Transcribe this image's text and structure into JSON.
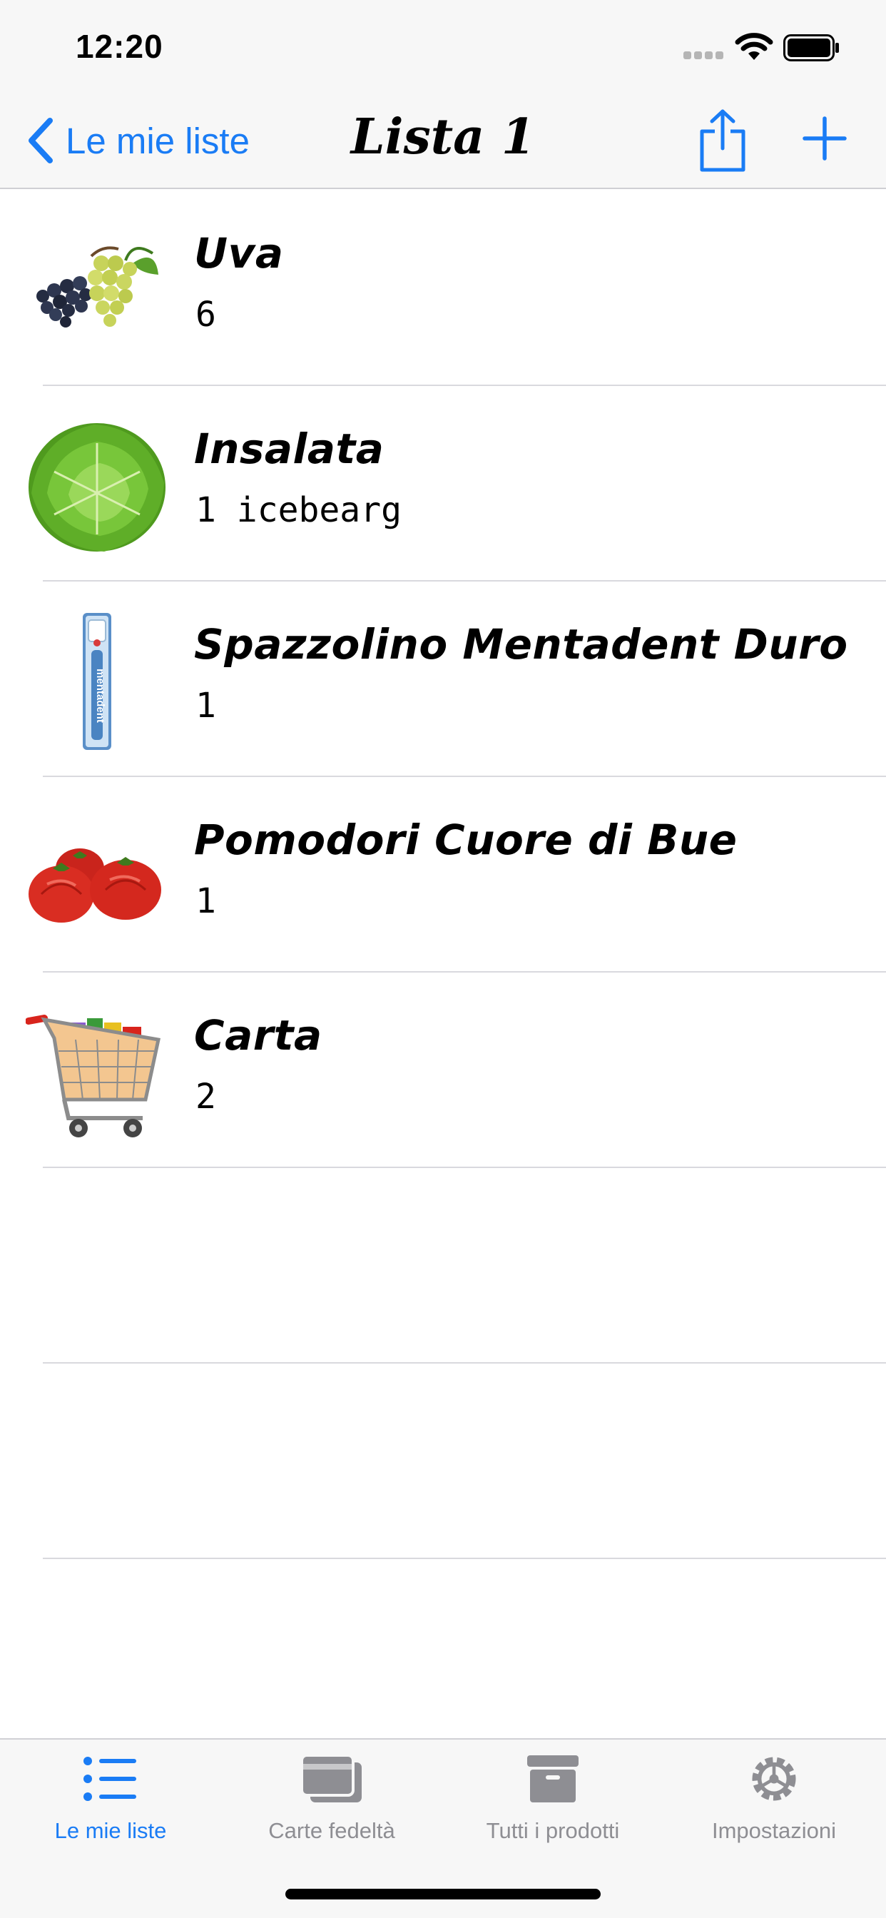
{
  "status_bar": {
    "time": "12:20"
  },
  "nav": {
    "back_label": "Le mie liste",
    "title": "Lista 1",
    "accent_color": "#1a7cf5"
  },
  "items": [
    {
      "name": "Uva",
      "quantity": "6",
      "icon": "grapes-icon"
    },
    {
      "name": "Insalata",
      "quantity": "1 icebearg",
      "icon": "lettuce-icon"
    },
    {
      "name": "Spazzolino Mentadent Duro",
      "quantity": "1",
      "icon": "toothbrush-icon",
      "brand_text": "mentadent"
    },
    {
      "name": "Pomodori Cuore di Bue",
      "quantity": "1",
      "icon": "tomatoes-icon"
    },
    {
      "name": "Carta",
      "quantity": "2",
      "icon": "shopping-cart-icon"
    }
  ],
  "tabs": [
    {
      "label": "Le mie liste",
      "icon": "list-icon",
      "active": true
    },
    {
      "label": "Carte fedeltà",
      "icon": "cards-icon",
      "active": false
    },
    {
      "label": "Tutti i prodotti",
      "icon": "archive-box-icon",
      "active": false
    },
    {
      "label": "Impostazioni",
      "icon": "gear-icon",
      "active": false
    }
  ]
}
